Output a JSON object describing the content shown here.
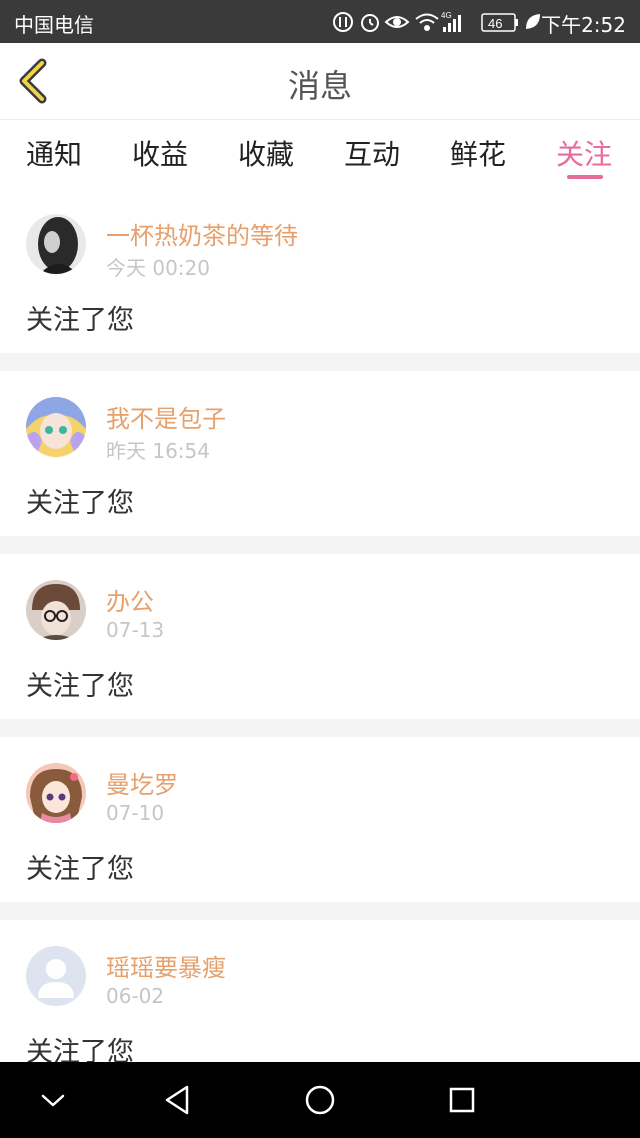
{
  "status_bar": {
    "carrier": "中国电信",
    "network": "4G",
    "battery": "46",
    "time": "下午2:52"
  },
  "header": {
    "title": "消息",
    "back_icon": "chevron-left-icon"
  },
  "tabs": [
    {
      "label": "通知"
    },
    {
      "label": "收益"
    },
    {
      "label": "收藏"
    },
    {
      "label": "互动"
    },
    {
      "label": "鲜花"
    },
    {
      "label": "关注",
      "active": true
    }
  ],
  "colors": {
    "accent": "#e86b9c",
    "name": "#e7a06b",
    "time": "#c6c6c6",
    "separator": "#f4f4f4"
  },
  "messages": [
    {
      "name": "一杯热奶茶的等待",
      "time": "今天 00:20",
      "text": "关注了您",
      "avatar": "dark-portrait-avatar"
    },
    {
      "name": "我不是包子",
      "time": "昨天 16:54",
      "text": "关注了您",
      "avatar": "anime-blue-hair-avatar"
    },
    {
      "name": "办公",
      "time": "07-13",
      "text": "关注了您",
      "avatar": "glasses-hat-avatar"
    },
    {
      "name": "曼圪罗",
      "time": "07-10",
      "text": "关注了您",
      "avatar": "anime-girl-avatar"
    },
    {
      "name": "瑶瑶要暴瘦",
      "time": "06-02",
      "text": "关注了您",
      "avatar": "default-user-avatar"
    }
  ],
  "nav_bar": {
    "buttons": [
      "collapse-icon",
      "back-triangle-icon",
      "home-circle-icon",
      "recents-square-icon"
    ]
  }
}
